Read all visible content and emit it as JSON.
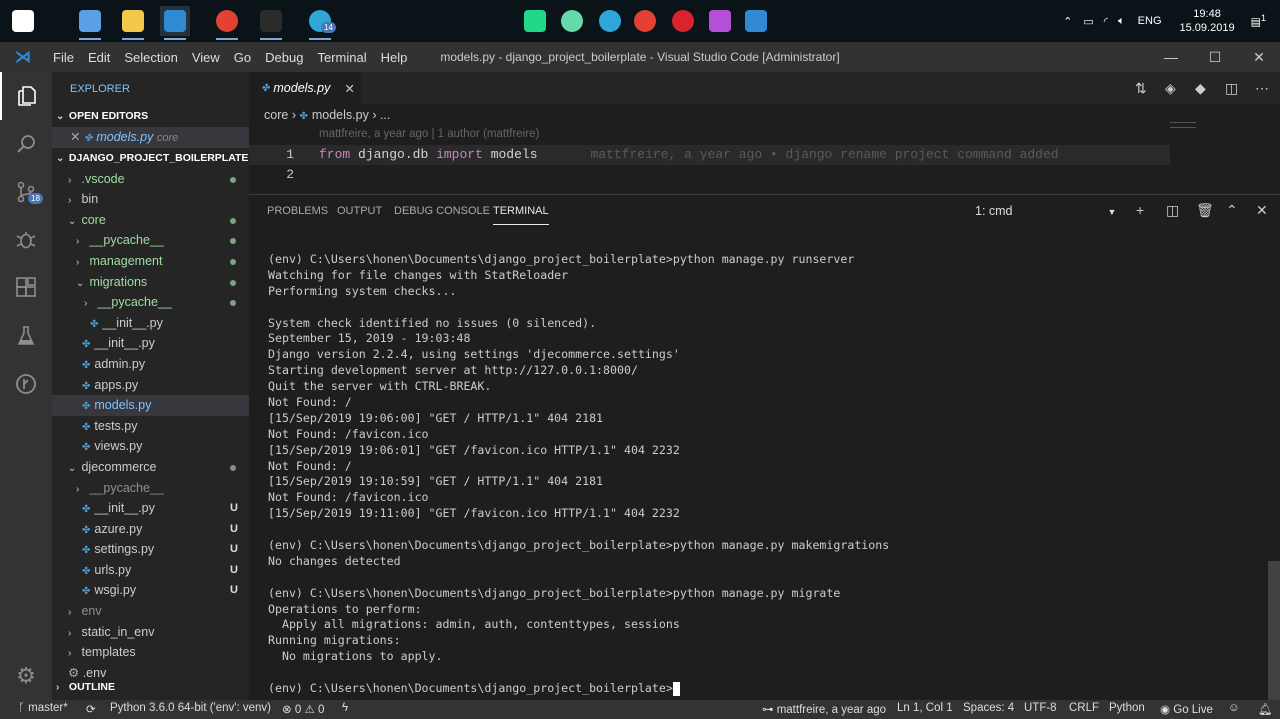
{
  "taskbar": {
    "apps": [
      {
        "name": "start-icon",
        "color": "#ffffff"
      },
      {
        "name": "this-pc-icon",
        "color": "#5aa0e6"
      },
      {
        "name": "file-explorer-icon",
        "color": "#f2c94c"
      },
      {
        "name": "vscode-icon",
        "color": "#2f89d3"
      },
      {
        "name": "chrome-icon",
        "color": "#e34133"
      },
      {
        "name": "cmd-icon",
        "color": "#2b2b2b"
      },
      {
        "name": "telegram-icon",
        "color": "#2ea6da"
      },
      {
        "name": "pycharm-icon",
        "color": "#21d789"
      },
      {
        "name": "atom-icon",
        "color": "#66d9a8"
      },
      {
        "name": "telegram-icon",
        "color": "#2ea6da"
      },
      {
        "name": "chrome-icon",
        "color": "#e34133"
      },
      {
        "name": "opera-icon",
        "color": "#d9232e"
      },
      {
        "name": "kraken-icon",
        "color": "#b54fd8"
      },
      {
        "name": "vscode-icon",
        "color": "#2f89d3"
      }
    ],
    "telegram_badge": "14",
    "language": "ENG",
    "time": "19:48",
    "date": "15.09.2019",
    "notification_count": "1"
  },
  "titlebar": {
    "menu": [
      "File",
      "Edit",
      "Selection",
      "View",
      "Go",
      "Debug",
      "Terminal",
      "Help"
    ],
    "title": "models.py - django_project_boilerplate - Visual Studio Code [Administrator]"
  },
  "activity": {
    "scm_badge": "18"
  },
  "sidebar": {
    "title": "EXPLORER",
    "open_editors_label": "OPEN EDITORS",
    "open_editor": {
      "name": "models.py",
      "dir": "core"
    },
    "project_label": "DJANGO_PROJECT_BOILERPLATE",
    "outline_label": "OUTLINE",
    "tree": [
      {
        "label": ".vscode",
        "kind": "folder",
        "open": false,
        "indent": 0,
        "status": "dot",
        "color": "#9fdca2"
      },
      {
        "label": "bin",
        "kind": "folder",
        "open": false,
        "indent": 0,
        "status": "",
        "color": "#cccccc"
      },
      {
        "label": "core",
        "kind": "folder",
        "open": true,
        "indent": 0,
        "status": "dot",
        "color": "#9fdca2"
      },
      {
        "label": "__pycache__",
        "kind": "folder",
        "open": false,
        "indent": 1,
        "status": "dot",
        "color": "#9fdca2"
      },
      {
        "label": "management",
        "kind": "folder",
        "open": false,
        "indent": 1,
        "status": "dot",
        "color": "#9fdca2"
      },
      {
        "label": "migrations",
        "kind": "folder",
        "open": true,
        "indent": 1,
        "status": "dot",
        "color": "#9fdca2"
      },
      {
        "label": "__pycache__",
        "kind": "folder",
        "open": false,
        "indent": 2,
        "status": "dot",
        "color": "#9fdca2"
      },
      {
        "label": "__init__.py",
        "kind": "file",
        "indent": 2,
        "status": "",
        "color": "#cccccc"
      },
      {
        "label": "__init__.py",
        "kind": "file",
        "indent": 1,
        "status": "",
        "color": "#cccccc"
      },
      {
        "label": "admin.py",
        "kind": "file",
        "indent": 1,
        "status": "",
        "color": "#cccccc"
      },
      {
        "label": "apps.py",
        "kind": "file",
        "indent": 1,
        "status": "",
        "color": "#cccccc"
      },
      {
        "label": "models.py",
        "kind": "file",
        "indent": 1,
        "status": "",
        "color": "#7fc4ff",
        "selected": true
      },
      {
        "label": "tests.py",
        "kind": "file",
        "indent": 1,
        "status": "",
        "color": "#cccccc"
      },
      {
        "label": "views.py",
        "kind": "file",
        "indent": 1,
        "status": "",
        "color": "#cccccc"
      },
      {
        "label": "djecommerce",
        "kind": "folder",
        "open": true,
        "indent": 0,
        "status": "dot-gray",
        "color": "#cccccc"
      },
      {
        "label": "__pycache__",
        "kind": "folder",
        "open": false,
        "indent": 1,
        "status": "",
        "color": "#8f8f8f"
      },
      {
        "label": "__init__.py",
        "kind": "file",
        "indent": 1,
        "status": "U",
        "color": "#cccccc"
      },
      {
        "label": "azure.py",
        "kind": "file",
        "indent": 1,
        "status": "U",
        "color": "#cccccc"
      },
      {
        "label": "settings.py",
        "kind": "file",
        "indent": 1,
        "status": "U",
        "color": "#cccccc"
      },
      {
        "label": "urls.py",
        "kind": "file",
        "indent": 1,
        "status": "U",
        "color": "#cccccc"
      },
      {
        "label": "wsgi.py",
        "kind": "file",
        "indent": 1,
        "status": "U",
        "color": "#cccccc"
      },
      {
        "label": "env",
        "kind": "folder",
        "open": false,
        "indent": 0,
        "status": "",
        "color": "#8f8f8f"
      },
      {
        "label": "static_in_env",
        "kind": "folder",
        "open": false,
        "indent": 0,
        "status": "",
        "color": "#cccccc"
      },
      {
        "label": "templates",
        "kind": "folder",
        "open": false,
        "indent": 0,
        "status": "",
        "color": "#cccccc"
      },
      {
        "label": ".env",
        "kind": "gear",
        "indent": 0,
        "status": "",
        "color": "#cccccc"
      }
    ]
  },
  "editor": {
    "tab_label": "models.py",
    "breadcrumb_folder": "core",
    "breadcrumb_file": "models.py",
    "breadcrumb_more": "...",
    "codelens": "mattfreire, a year ago | 1 author (mattfreire)",
    "line1_number": "1",
    "line2_number": "2",
    "line1_from": "from",
    "line1_module": "django.db",
    "line1_import": "import",
    "line1_name": "models",
    "line1_blame": "mattfreire, a year ago • django rename project command added"
  },
  "panel": {
    "tabs": [
      "PROBLEMS",
      "OUTPUT",
      "DEBUG CONSOLE",
      "TERMINAL"
    ],
    "active_tab": "TERMINAL",
    "terminal_select": "1: cmd",
    "terminal_lines": [
      "(env) C:\\Users\\honen\\Documents\\django_project_boilerplate>python manage.py runserver",
      "Watching for file changes with StatReloader",
      "Performing system checks...",
      "",
      "System check identified no issues (0 silenced).",
      "September 15, 2019 - 19:03:48",
      "Django version 2.2.4, using settings 'djecommerce.settings'",
      "Starting development server at http://127.0.0.1:8000/",
      "Quit the server with CTRL-BREAK.",
      "Not Found: /",
      "[15/Sep/2019 19:06:00] \"GET / HTTP/1.1\" 404 2181",
      "Not Found: /favicon.ico",
      "[15/Sep/2019 19:06:01] \"GET /favicon.ico HTTP/1.1\" 404 2232",
      "Not Found: /",
      "[15/Sep/2019 19:10:59] \"GET / HTTP/1.1\" 404 2181",
      "Not Found: /favicon.ico",
      "[15/Sep/2019 19:11:00] \"GET /favicon.ico HTTP/1.1\" 404 2232",
      "",
      "(env) C:\\Users\\honen\\Documents\\django_project_boilerplate>python manage.py makemigrations",
      "No changes detected",
      "",
      "(env) C:\\Users\\honen\\Documents\\django_project_boilerplate>python manage.py migrate",
      "Operations to perform:",
      "  Apply all migrations: admin, auth, contenttypes, sessions",
      "Running migrations:",
      "  No migrations to apply.",
      ""
    ],
    "prompt": "(env) C:\\Users\\honen\\Documents\\django_project_boilerplate>"
  },
  "statusbar": {
    "branch": "master*",
    "python": "Python 3.6.0 64-bit ('env': venv)",
    "errors": "0",
    "warnings": "0",
    "blame": "mattfreire, a year ago",
    "position": "Ln 1, Col 1",
    "spaces": "Spaces: 4",
    "encoding": "UTF-8",
    "eol": "CRLF",
    "language": "Python",
    "golive": "Go Live"
  }
}
